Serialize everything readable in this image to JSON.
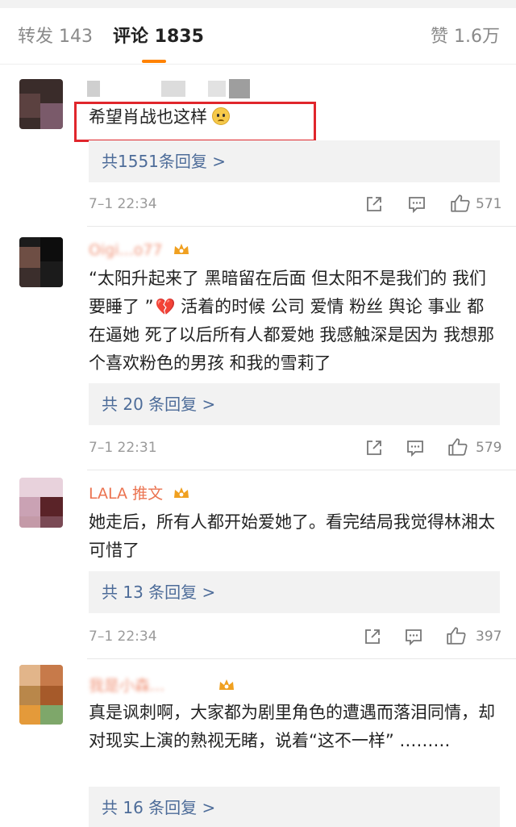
{
  "tabs": {
    "repost": "转发 143",
    "comment": "评论 1835",
    "like": "赞 1.6万"
  },
  "comments": [
    {
      "username": "",
      "text": "希望肖战也这样",
      "replies": "共1551条回复 >",
      "time": "7–1 22:34",
      "likes": "571"
    },
    {
      "username": "Oigi...o77",
      "text": "“太阳升起来了 黑暗留在后面 但太阳不是我们的 我们要睡了 ”",
      "text_after": " 活着的时候 公司 爱情 粉丝 舆论 事业 都在逼她 死了以后所有人都爱她 我感触深是因为 我想那个喜欢粉色的男孩 和我的雪莉了",
      "replies": "共 20 条回复 >",
      "time": "7–1 22:31",
      "likes": "579"
    },
    {
      "username": "LALA 推文",
      "text": "她走后，所有人都开始爱她了。看完结局我觉得林湘太可惜了",
      "replies": "共 13 条回复 >",
      "time": "7–1 22:34",
      "likes": "397"
    },
    {
      "username": "我是小森...",
      "text": "真是讽刺啊，大家都为剧里角色的遭遇而落泪同情，却对现实上演的熟视无睹，说着“这不一样” ………",
      "replies": "共 16 条回复 >"
    }
  ],
  "icons": {
    "share": "share-icon",
    "comment": "comment-icon",
    "like": "thumbs-up-icon",
    "vip": "vip-crown-icon",
    "heart": "broken-heart-icon",
    "emoji": "pleading-face-icon"
  },
  "colors": {
    "accent": "#ff8200",
    "username": "#eb7350",
    "reply_link": "#4d6c99",
    "highlight": "#e0262c"
  }
}
